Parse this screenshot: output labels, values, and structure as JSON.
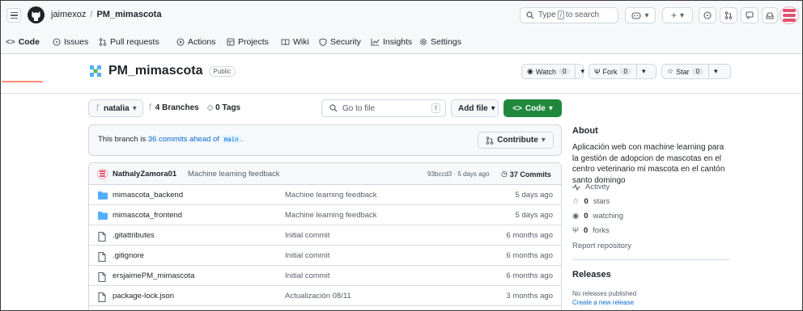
{
  "header": {
    "owner": "jaimexoz",
    "repo": "PM_mimascota",
    "search_pre": "Type",
    "search_key": "/",
    "search_post": "to search"
  },
  "tabs": [
    {
      "label": "Code",
      "icon": "code-icon"
    },
    {
      "label": "Issues",
      "icon": "issue-icon"
    },
    {
      "label": "Pull requests",
      "icon": "pull-request-icon"
    },
    {
      "label": "Actions",
      "icon": "play-icon"
    },
    {
      "label": "Projects",
      "icon": "table-icon"
    },
    {
      "label": "Wiki",
      "icon": "book-icon"
    },
    {
      "label": "Security",
      "icon": "shield-icon"
    },
    {
      "label": "Insights",
      "icon": "graph-icon"
    },
    {
      "label": "Settings",
      "icon": "gear-icon"
    }
  ],
  "repo": {
    "name": "PM_mimascota",
    "visibility": "Public",
    "watch_label": "Watch",
    "watch_count": "0",
    "fork_label": "Fork",
    "fork_count": "0",
    "star_label": "Star",
    "star_count": "0"
  },
  "toolbar": {
    "branch": "natalia",
    "branches": "4 Branches",
    "tags": "0 Tags",
    "goto_placeholder": "Go to file",
    "goto_key": "t",
    "add_file": "Add file",
    "code": "Code"
  },
  "banner": {
    "pre": "This branch is",
    "commits_ahead": "36 commits ahead of",
    "base": "main",
    "post": ".",
    "contribute": "Contribute"
  },
  "latest_commit": {
    "author": "NathalyZamora01",
    "message": "Machine learning feedback",
    "hash": "93bccd3 · 5 days ago",
    "total": "37 Commits"
  },
  "files": [
    {
      "type": "folder",
      "name": "mimascota_backend",
      "message": "Machine learning feedback",
      "date": "5 days ago"
    },
    {
      "type": "folder",
      "name": "mimascota_frontend",
      "message": "Machine learning feedback",
      "date": "5 days ago"
    },
    {
      "type": "file",
      "name": ".gitattributes",
      "message": "Initial commit",
      "date": "6 months ago"
    },
    {
      "type": "file",
      "name": ".gitignore",
      "message": "Initial commit",
      "date": "6 months ago"
    },
    {
      "type": "file",
      "name": "ersjaimePM_mimascota",
      "message": "Initial commit",
      "date": "6 months ago"
    },
    {
      "type": "file",
      "name": "package-lock.json",
      "message": "Actualización 08/11",
      "date": "3 months ago"
    }
  ],
  "about": {
    "title": "About",
    "description": "Aplicación web con machine learning para la gestión de adopcion de mascotas en el centro veterinario mi mascota en el cantón santo domingo",
    "activity": "Activity",
    "stars_num": "0",
    "stars": "stars",
    "watching_num": "0",
    "watching": "watching",
    "forks_num": "0",
    "forks": "forks",
    "report": "Report repository"
  },
  "releases": {
    "title": "Releases",
    "none": "No releases published",
    "create": "Create a new release"
  },
  "colors": {
    "accent_green": "#1f883d",
    "link_blue": "#0969da",
    "folder_blue": "#54aeff",
    "tab_underline": "#fd8c73"
  }
}
